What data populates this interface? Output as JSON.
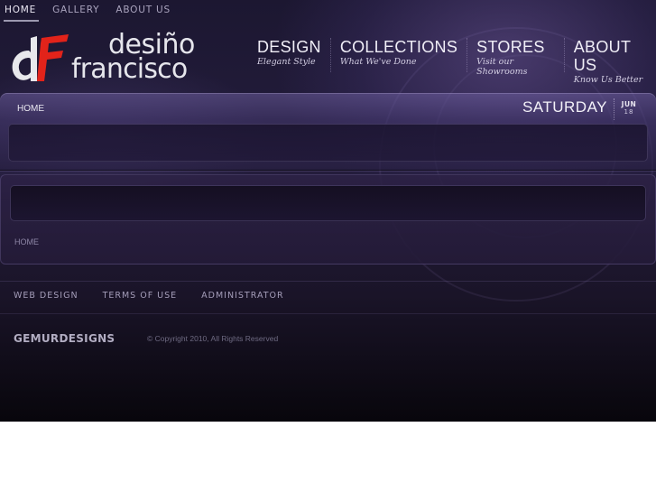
{
  "top_nav": {
    "items": [
      {
        "label": "HOME",
        "active": true
      },
      {
        "label": "GALLERY",
        "active": false
      },
      {
        "label": "ABOUT US",
        "active": false
      }
    ]
  },
  "logo": {
    "line1": "desiño",
    "line2": "francisco",
    "monogram_color_d": "#e8e8ec",
    "monogram_color_f": "#e2231a"
  },
  "main_nav": {
    "items": [
      {
        "title": "DESIGN",
        "subtitle": "Elegant Style"
      },
      {
        "title": "COLLECTIONS",
        "subtitle": "What We've Done"
      },
      {
        "title": "STORES",
        "subtitle": "Visit our Showrooms"
      },
      {
        "title": "ABOUT US",
        "subtitle": "Know Us Better"
      }
    ]
  },
  "header_band": {
    "breadcrumb": "HOME",
    "day": "SATURDAY",
    "month": "JUN",
    "date": "18"
  },
  "content": {
    "breadcrumb": "HOME"
  },
  "footer": {
    "links": [
      "WEB DESIGN",
      "TERMS OF USE",
      "ADMINISTRATOR"
    ],
    "brand": "GEMURDESIGNS",
    "copyright": "© Copyright 2010, All Rights Reserved"
  },
  "colors": {
    "accent_red": "#e2231a",
    "background_dark": "#1c1731"
  }
}
